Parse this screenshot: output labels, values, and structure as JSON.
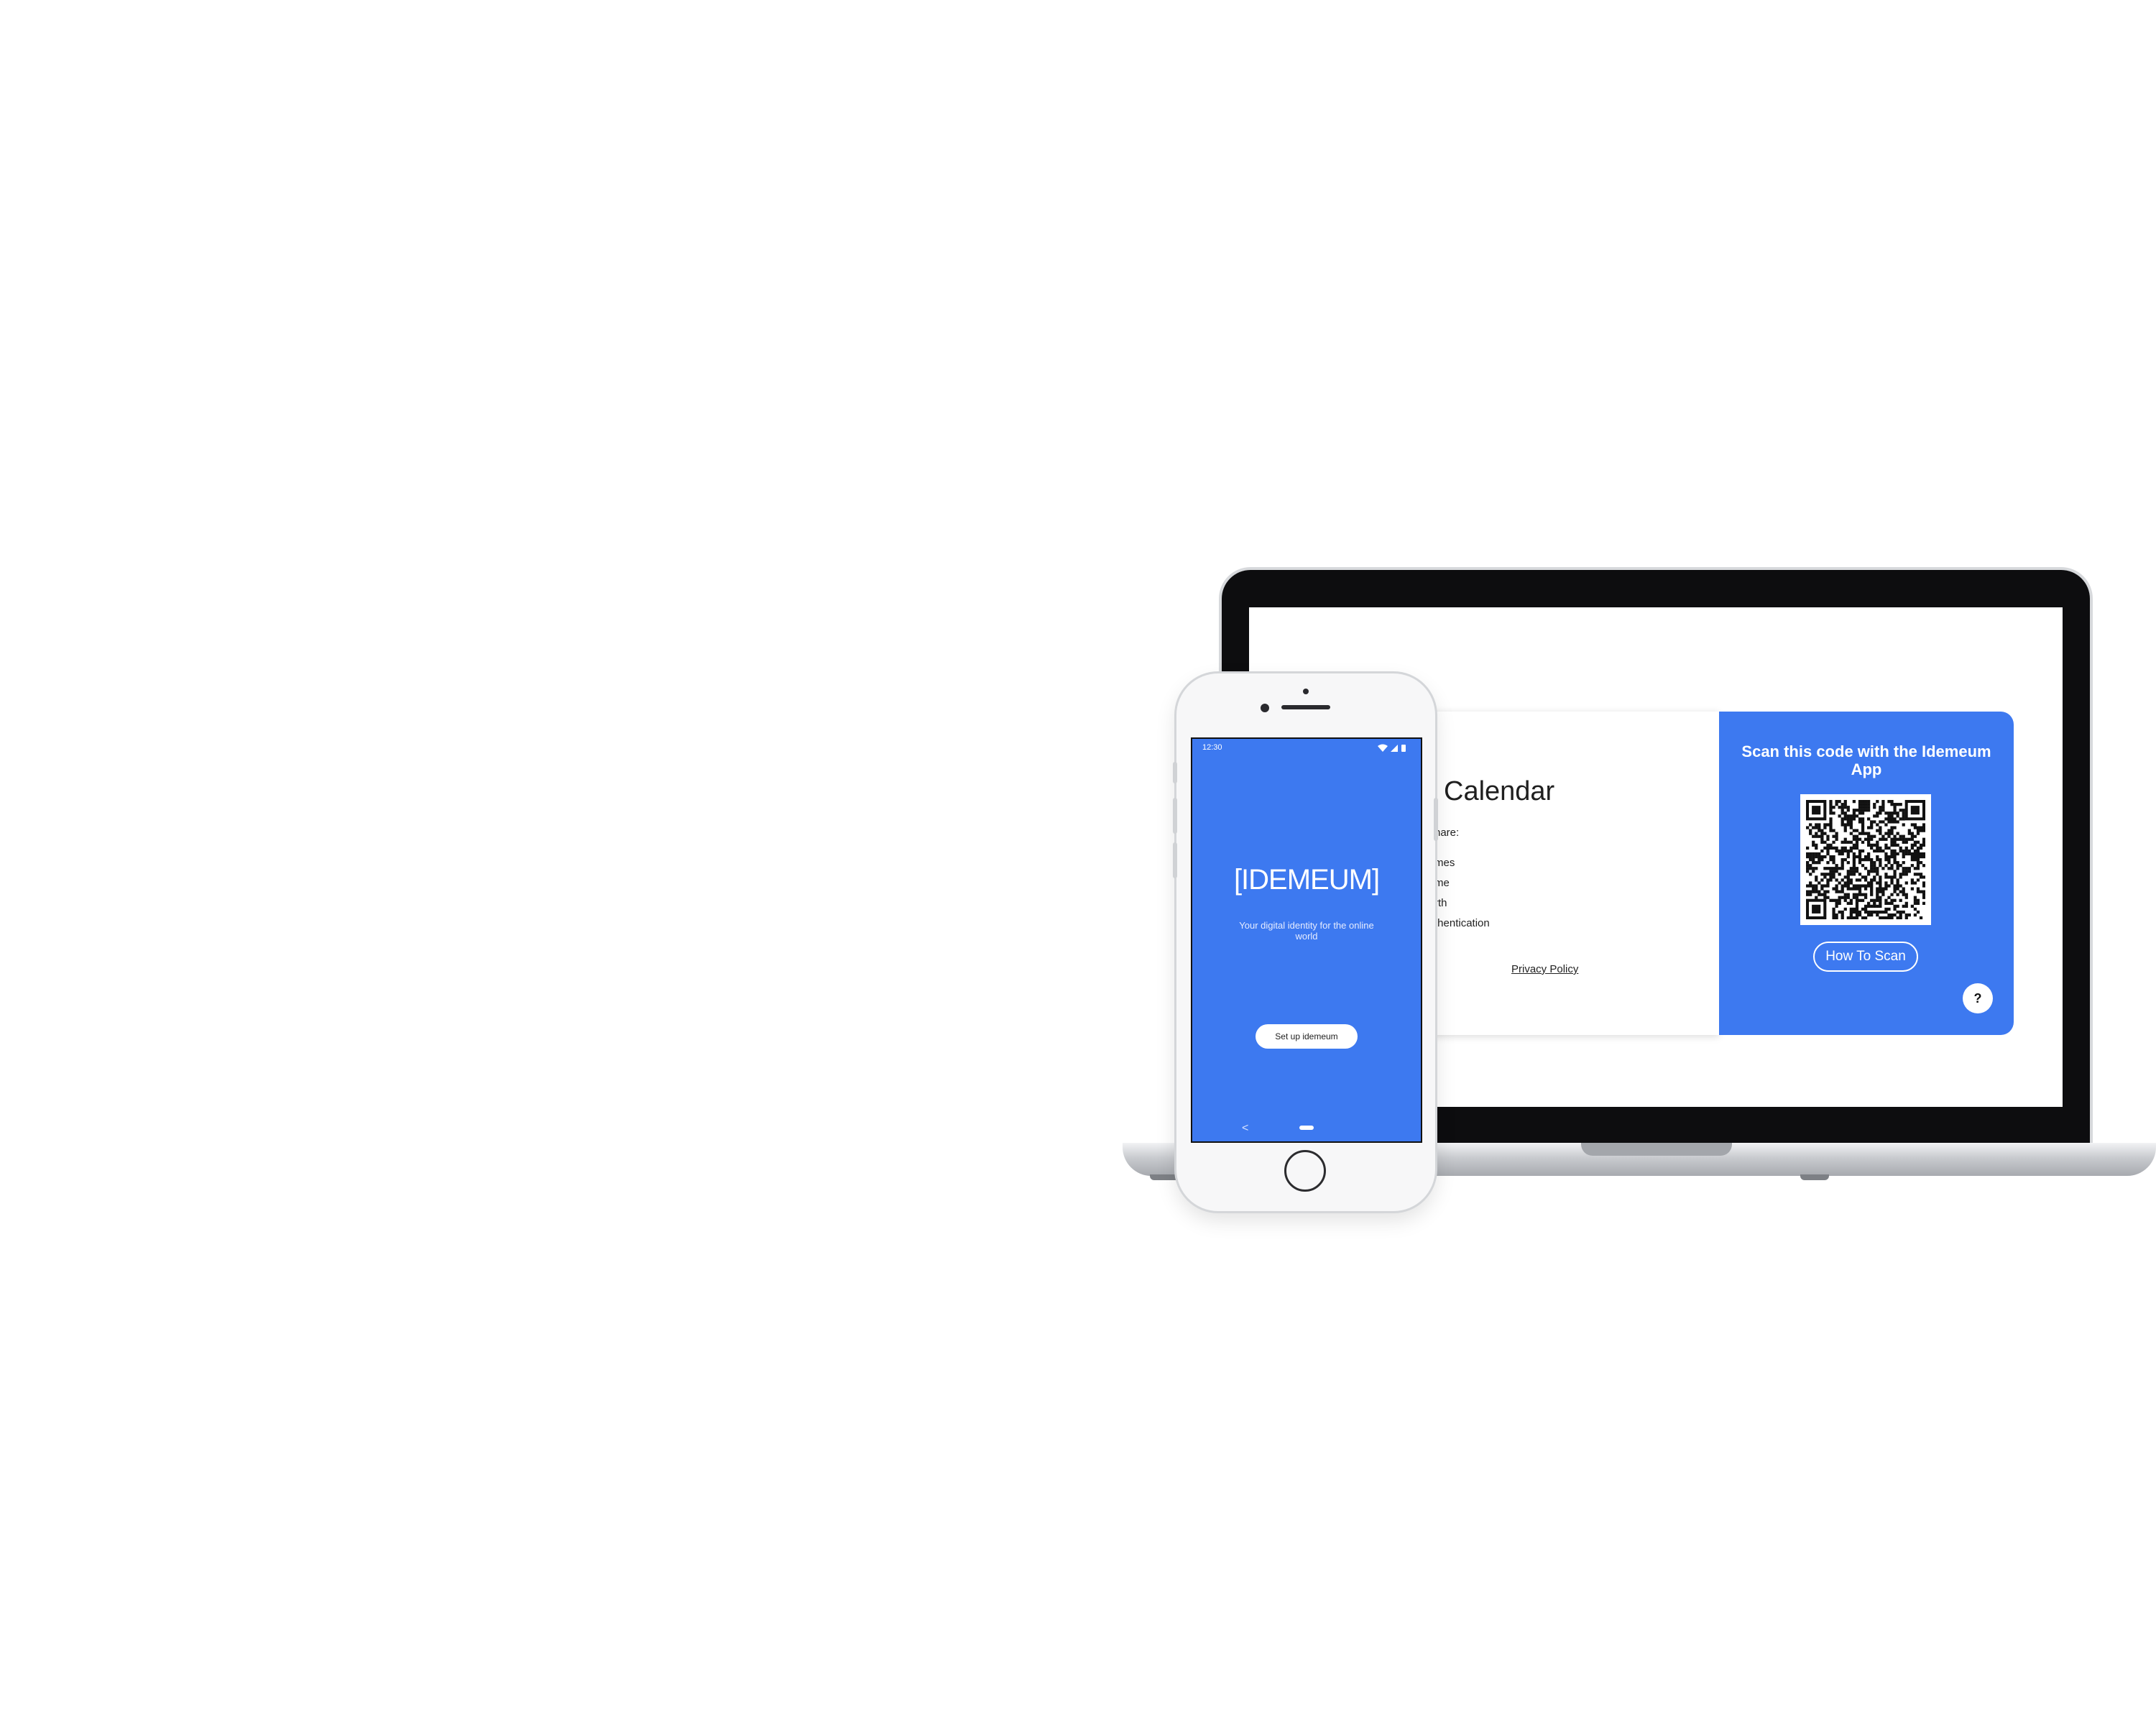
{
  "colors": {
    "brand_blue": "#3d79f0",
    "laptop_bezel": "#0d0d0f",
    "white": "#ffffff"
  },
  "laptop": {
    "consent_dialog": {
      "title_fragment": "Calendar",
      "share_prefix": "hare:",
      "attributes": [
        "mes",
        "me",
        "rth",
        "thentication"
      ],
      "privacy_link": "Privacy Policy"
    },
    "scan_panel": {
      "title": "Scan this code with the Idemeum App",
      "how_to_scan": "How To Scan",
      "help": "?"
    }
  },
  "phone": {
    "status_time": "12:30",
    "brand": "[IDEMEUM]",
    "tagline": "Your digital identity for the online world",
    "setup_button": "Set up idemeum",
    "nav_back": "<"
  }
}
